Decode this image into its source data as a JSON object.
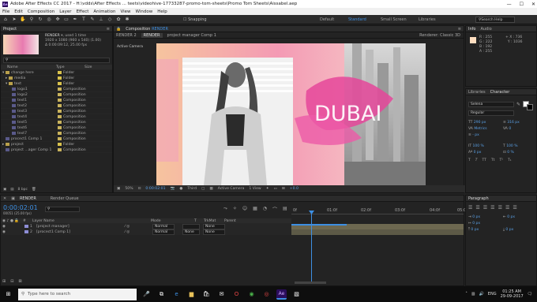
{
  "titlebar": {
    "title": "Adobe After Effects CC 2017 - H:\\vdds\\After Effects ... teets\\videohive-17733287-promo-tom-sheets\\Promo Tom Sheets\\Aissabel.aep",
    "app_badge": "Ae",
    "minimize": "—",
    "maximize": "☐",
    "close": "✕"
  },
  "menu": [
    "File",
    "Edit",
    "Composition",
    "Layer",
    "Effect",
    "Animation",
    "View",
    "Window",
    "Help"
  ],
  "toolbar": {
    "snapping": "Snapping",
    "workspaces": [
      "Default",
      "Standard",
      "Small Screen",
      "Libraries"
    ],
    "active_workspace": "Standard",
    "search_placeholder": "Search Help"
  },
  "project": {
    "tab": "Project",
    "comp_name": "RENDER",
    "comp_used": "▾, used 1 time",
    "comp_size": "1920 x 1080 (960 x 540) (1.00)",
    "comp_duration": "Δ 0:00:09:12, 25.00 fps",
    "search_placeholder": "",
    "columns": [
      "Name",
      "Type",
      "Size"
    ],
    "items": [
      {
        "name": "change here",
        "type": "Folder",
        "color": "#d9c24c",
        "indent": 0,
        "expand": "▾",
        "icon": "folder"
      },
      {
        "name": "media",
        "type": "Folder",
        "color": "#d9c24c",
        "indent": 1,
        "expand": "▸",
        "icon": "folder"
      },
      {
        "name": "text",
        "type": "Folder",
        "color": "#d9c24c",
        "indent": 1,
        "expand": "▾",
        "icon": "folder"
      },
      {
        "name": "logo1",
        "type": "Composition",
        "color": "#c9b35c",
        "indent": 2,
        "expand": "",
        "icon": "comp"
      },
      {
        "name": "logo2",
        "type": "Composition",
        "color": "#c9b35c",
        "indent": 2,
        "expand": "",
        "icon": "comp"
      },
      {
        "name": "text1",
        "type": "Composition",
        "color": "#c9b35c",
        "indent": 2,
        "expand": "",
        "icon": "comp"
      },
      {
        "name": "text2",
        "type": "Composition",
        "color": "#c9b35c",
        "indent": 2,
        "expand": "",
        "icon": "comp"
      },
      {
        "name": "text3",
        "type": "Composition",
        "color": "#c9b35c",
        "indent": 2,
        "expand": "",
        "icon": "comp"
      },
      {
        "name": "text4",
        "type": "Composition",
        "color": "#c9b35c",
        "indent": 2,
        "expand": "",
        "icon": "comp"
      },
      {
        "name": "text5",
        "type": "Composition",
        "color": "#c9b35c",
        "indent": 2,
        "expand": "",
        "icon": "comp"
      },
      {
        "name": "text6",
        "type": "Composition",
        "color": "#c9b35c",
        "indent": 2,
        "expand": "",
        "icon": "comp"
      },
      {
        "name": "text7",
        "type": "Composition",
        "color": "#c9b35c",
        "indent": 2,
        "expand": "",
        "icon": "comp"
      },
      {
        "name": "procect1 Comp 1",
        "type": "Composition",
        "color": "#c9b35c",
        "indent": 0,
        "expand": "",
        "icon": "comp"
      },
      {
        "name": "project",
        "type": "Folder",
        "color": "#d9c24c",
        "indent": 0,
        "expand": "▸",
        "icon": "folder"
      },
      {
        "name": "project ...ager Comp 1",
        "type": "Composition",
        "color": "#c9b35c",
        "indent": 0,
        "expand": "",
        "icon": "comp"
      }
    ],
    "bpc": "8 bpc"
  },
  "composition": {
    "panel_label": "Composition",
    "panel_comp": "RENDER",
    "tabs": [
      "RENDER 2",
      "RENDER",
      "project manager Comp 1"
    ],
    "active_tab": "RENDER",
    "renderer": "Renderer: Classic 3D",
    "active_camera": "Active Camera",
    "overlay_text": "DUBAI",
    "bottom": {
      "zoom": "50%",
      "timecode": "0:00:02:01",
      "resolution": "Third",
      "camera": "Active Camera",
      "views": "1 View",
      "exposure": "+0.0"
    }
  },
  "info": {
    "tabs": [
      "Info",
      "Audio"
    ],
    "r_label": "R :",
    "r": "255",
    "g_label": "G :",
    "g": "222",
    "b_label": "B :",
    "b": "192",
    "a_label": "A :",
    "a": "255",
    "x_label": "X :",
    "x": "736",
    "y_label": "Y :",
    "y": "1036",
    "swatch": "#ffdec0"
  },
  "character": {
    "tabs": [
      "Libraries",
      "Character"
    ],
    "font": "Selena",
    "style": "Regular",
    "font_size": "290 px",
    "leading": "316 px",
    "kerning": "Metrics",
    "tracking": "0",
    "stroke_width": "- px",
    "vscale": "100 %",
    "hscale": "100 %",
    "baseline": "0 px",
    "tsume": "0 %",
    "styles": [
      "T",
      "T",
      "TT",
      "Tt",
      "T¹",
      "T₁"
    ]
  },
  "timeline": {
    "tabs": [
      "RENDER",
      "Render Queue"
    ],
    "timecode": "0:00:02:01",
    "frame_info": "00051 (25.00 fps)",
    "search_placeholder": "",
    "columns": [
      "#",
      "Layer Name",
      "Mode",
      "T",
      "TrkMat",
      "Parent"
    ],
    "layers": [
      {
        "num": "1",
        "name": "[project manager]",
        "mode": "Normal",
        "trkmat": "",
        "parent": "None",
        "color": "#8e8ed6"
      },
      {
        "num": "2",
        "name": "[procect1 Comp 1]",
        "mode": "Normal",
        "trkmat": "None",
        "parent": "None",
        "color": "#8e8ed6"
      }
    ],
    "ruler": [
      "0f",
      "01:0f",
      "02:0f",
      "03:0f",
      "04:0f",
      "05:0f"
    ],
    "toggle_label": "Toggle Switches / Modes"
  },
  "paragraph": {
    "tab": "Paragraph",
    "indent_left": "0 px",
    "indent_right": "0 px",
    "first_line": "0 px",
    "space_before": "0 px",
    "space_after": "0 px"
  },
  "taskbar": {
    "search_placeholder": "Type here to search",
    "lang": "ENG",
    "time": "01:25 AM",
    "date": "29-09-2017"
  },
  "colors": {
    "accent": "#3d8fe3",
    "playhead": "#3d8fe3",
    "label_purple": "#8e8ed6",
    "panel_bg": "#232323"
  }
}
